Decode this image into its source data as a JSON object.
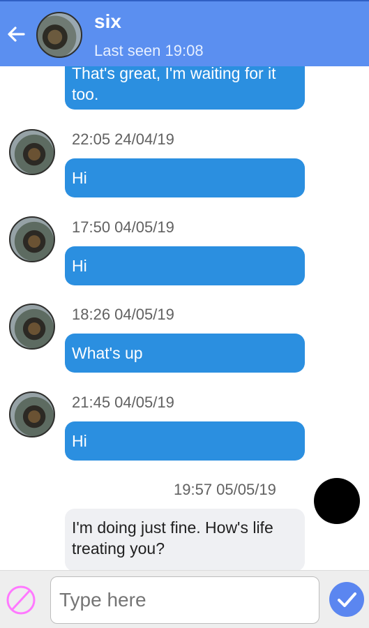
{
  "header": {
    "contact_name": "six",
    "status": "Last seen 19:08"
  },
  "messages": [
    {
      "direction": "in",
      "timestamp": "",
      "text": "That's great, I'm waiting for it too."
    },
    {
      "direction": "in",
      "timestamp": "22:05 24/04/19",
      "text": "Hi"
    },
    {
      "direction": "in",
      "timestamp": "17:50 04/05/19",
      "text": "Hi"
    },
    {
      "direction": "in",
      "timestamp": "18:26 04/05/19",
      "text": "What's up"
    },
    {
      "direction": "in",
      "timestamp": "21:45 04/05/19",
      "text": "Hi"
    },
    {
      "direction": "out",
      "timestamp": "19:57 05/05/19",
      "text": "I'm doing just fine. How's life treating you?"
    }
  ],
  "composer": {
    "placeholder": "Type here"
  },
  "colors": {
    "header": "#5b8ff0",
    "incoming_bubble": "#2b8fe0",
    "outgoing_bubble": "#eff0f3",
    "send_button": "#5b86f0",
    "block_icon": "#ff79ff"
  },
  "icons": {
    "back": "arrow-left-icon",
    "block": "block-icon",
    "send": "check-icon"
  }
}
